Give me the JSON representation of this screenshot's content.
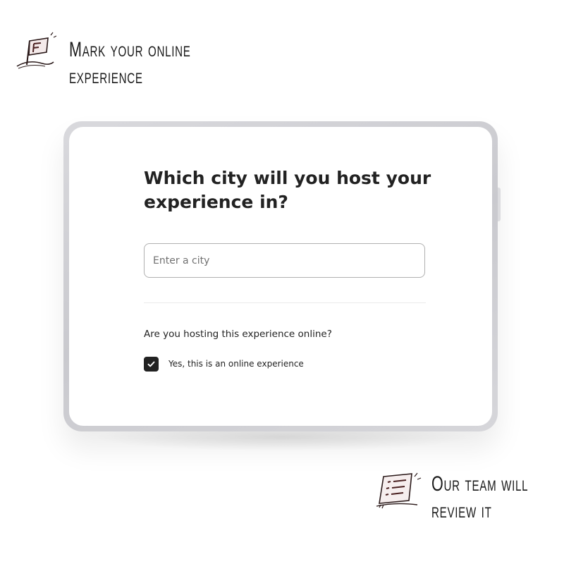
{
  "annotations": {
    "top": [
      "Mark your online",
      "experience"
    ],
    "bottom": [
      "Our team will",
      "review it"
    ]
  },
  "icons": {
    "top_doodle": "flag-sketch-icon",
    "bottom_doodle": "checklist-sketch-icon",
    "checkbox": "checkmark-icon"
  },
  "form": {
    "title": "Which city will you host your experience in?",
    "city_input": {
      "value": "",
      "placeholder": "Enter a city"
    },
    "online_question": "Are you hosting this experience online?",
    "online_checkbox": {
      "checked": true,
      "label": "Yes, this is an online experience"
    }
  },
  "colors": {
    "text": "#222222",
    "checkbox_fill": "#222222",
    "input_border": "#b0b0b0",
    "placeholder": "#717171",
    "divider": "#ebebeb"
  }
}
